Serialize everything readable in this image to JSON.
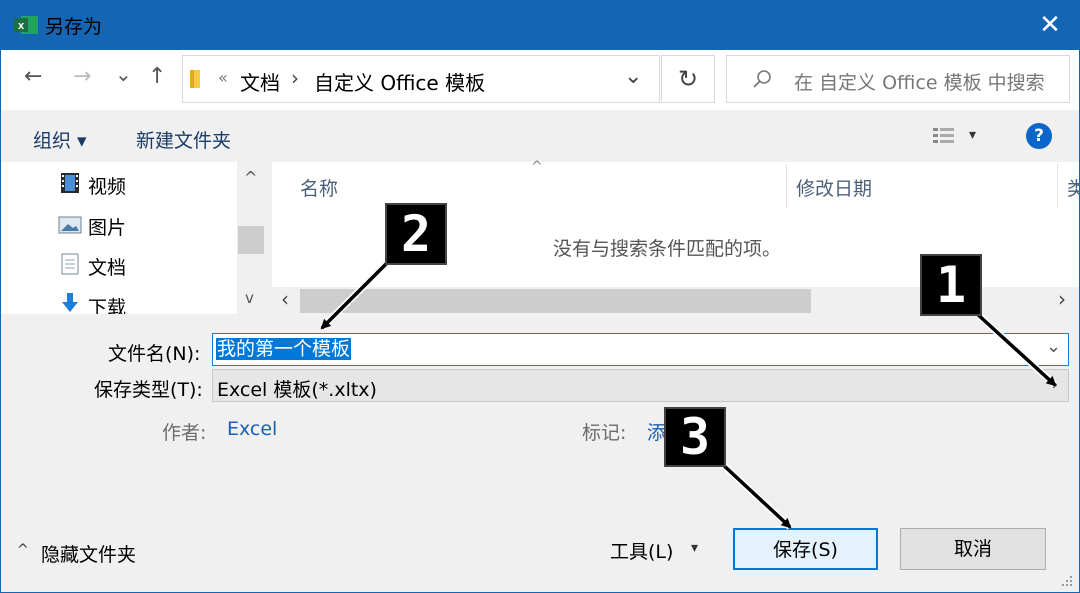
{
  "window": {
    "title": "另存为",
    "close_glyph": "✕"
  },
  "nav": {
    "back": "←",
    "forward": "→",
    "recent": "⌄",
    "up": "↑",
    "path_overflow": "«",
    "path": [
      "文档",
      "自定义 Office 模板"
    ],
    "path_sep": "›",
    "dropdown": "⌄",
    "refresh": "↻",
    "search_placeholder": "在 自定义 Office 模板 中搜索"
  },
  "toolbar": {
    "organize": "组织 ▾",
    "new_folder": "新建文件夹",
    "view_dropdown": "▾",
    "help": "?"
  },
  "sidebar": {
    "items": [
      {
        "label": "视频",
        "icon": "video-icon"
      },
      {
        "label": "图片",
        "icon": "pictures-icon"
      },
      {
        "label": "文档",
        "icon": "documents-icon"
      },
      {
        "label": "下载",
        "icon": "download-icon"
      }
    ],
    "scroll_up": "^",
    "scroll_down": "v"
  },
  "file_list": {
    "sort_indicator": "^",
    "columns": [
      "名称",
      "修改日期",
      "类"
    ],
    "empty_message": "没有与搜索条件匹配的项。",
    "scroll_left": "‹",
    "scroll_right": "›"
  },
  "form": {
    "filename_label": "文件名(N):",
    "filename_value": "我的第一个模板",
    "filetype_label": "保存类型(T):",
    "filetype_value": "Excel 模板(*.xltx)",
    "author_label": "作者:",
    "author_value": "Excel",
    "tags_label": "标记:",
    "tags_value": "添"
  },
  "footer": {
    "hide_folders": "隐藏文件夹",
    "hide_folders_glyph": "^",
    "tools": "工具(L)",
    "tools_glyph": "▾",
    "save": "保存(S)",
    "cancel": "取消"
  },
  "callouts": [
    "1",
    "2",
    "3"
  ],
  "colors": {
    "titlebar": "#1565b5",
    "accent": "#0078d7",
    "excel_green": "#1d6f42"
  }
}
